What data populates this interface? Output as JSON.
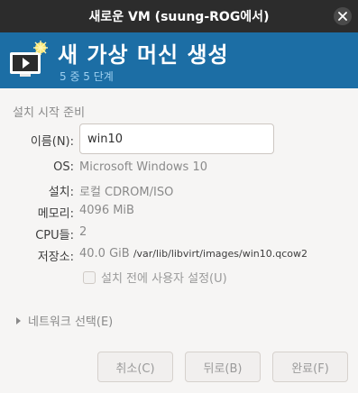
{
  "window": {
    "title": "새로운 VM (suung-ROG에서)",
    "close_icon": "close-icon"
  },
  "header": {
    "title": "새 가상 머신 생성",
    "step": "5 중 5 단계",
    "icon": "monitor-new-icon",
    "background_color": "#1c6ea5"
  },
  "section": {
    "title": "설치 시작 준비"
  },
  "form": {
    "name_label": "이름(N):",
    "name_value": "win10",
    "os_label": "OS:",
    "os_value": "Microsoft Windows 10",
    "install_label": "설치:",
    "install_value": "로컬 CDROM/ISO",
    "memory_label": "메모리:",
    "memory_value": "4096 MiB",
    "cpu_label": "CPU들:",
    "cpu_value": "2",
    "storage_label": "저장소:",
    "storage_size": "40.0 GiB",
    "storage_path": "/var/lib/libvirt/images/win10.qcow2",
    "customize_checkbox_label": "설치 전에 사용자 설정(U)",
    "customize_checked": false
  },
  "network": {
    "expander_label": "네트워크 선택(E)"
  },
  "buttons": {
    "cancel": "취소(C)",
    "back": "뒤로(B)",
    "finish": "완료(F)"
  }
}
